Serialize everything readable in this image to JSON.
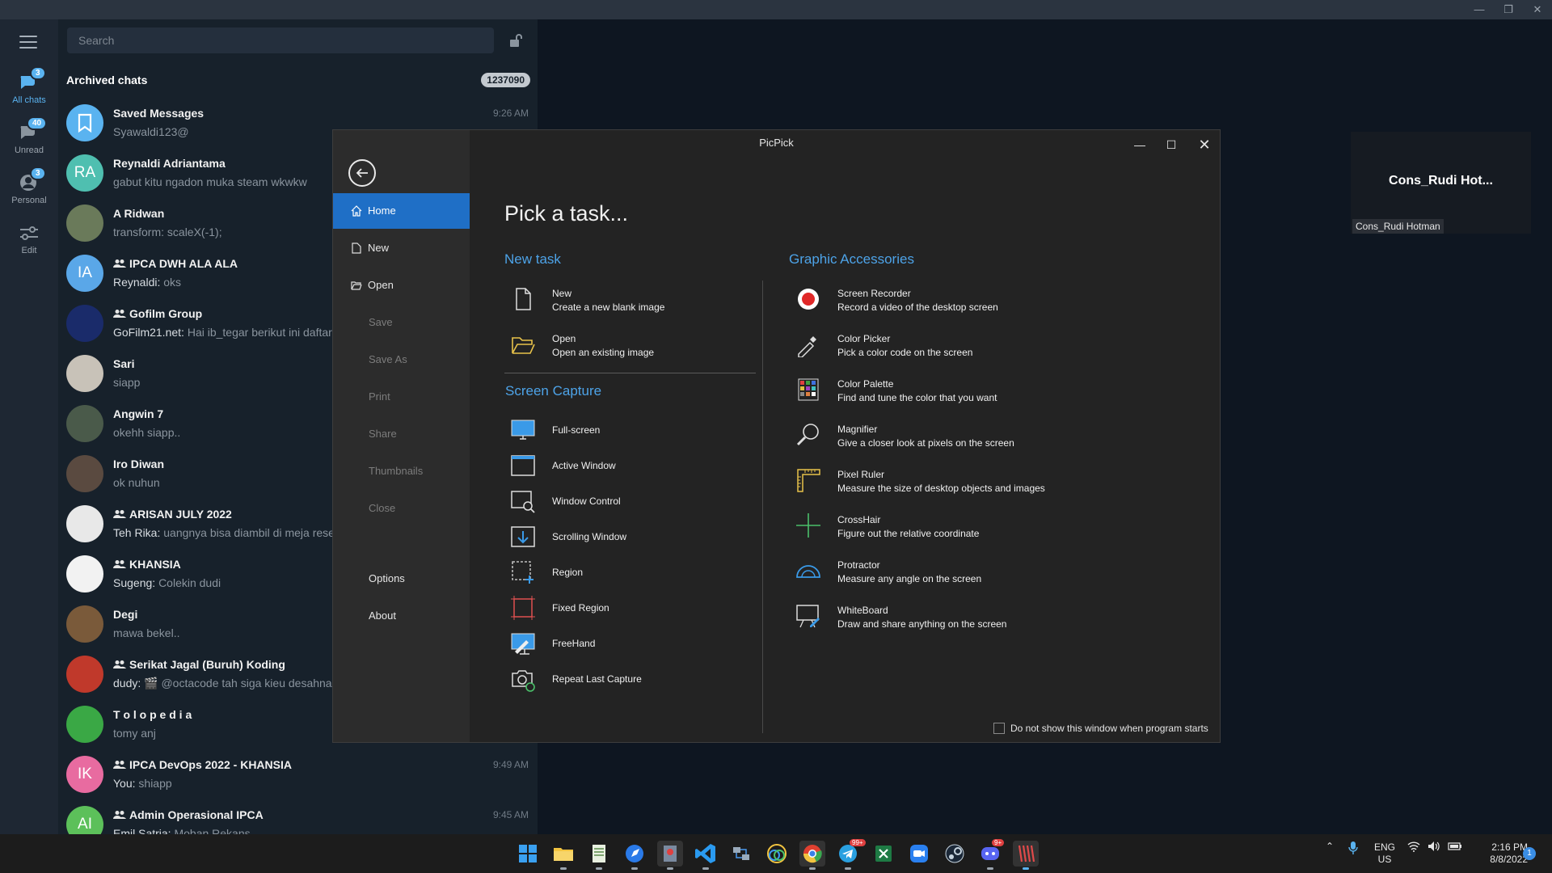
{
  "window": {
    "min": "—",
    "max": "❐",
    "close": "✕"
  },
  "rail": {
    "folders": [
      {
        "label": "All chats",
        "badge": "3"
      },
      {
        "label": "Unread",
        "badge": "40"
      },
      {
        "label": "Personal",
        "badge": "3"
      },
      {
        "label": "Edit",
        "badge": ""
      }
    ]
  },
  "chatlist": {
    "search_placeholder": "Search",
    "archived_title": "Archived chats",
    "archived_count": "1237090",
    "chats": [
      {
        "name": "Saved Messages",
        "sender": "",
        "text": "Syawaldi123@",
        "time": "9:26 AM",
        "initials": "",
        "color": "#5ab3f0",
        "group": false
      },
      {
        "name": "Reynaldi Adriantama",
        "sender": "",
        "text": "gabut kitu ngadon muka steam wkwkw",
        "time": "",
        "initials": "RA",
        "color": "#4fbfb0",
        "group": false
      },
      {
        "name": "A Ridwan",
        "sender": "",
        "text": "transform: scaleX(-1);",
        "time": "",
        "initials": "",
        "color": "#6a7a5a",
        "group": false
      },
      {
        "name": "IPCA DWH ALA ALA",
        "sender": "Reynaldi:",
        "text": "oks",
        "time": "",
        "initials": "IA",
        "color": "#5aa7e8",
        "group": true
      },
      {
        "name": "Gofilm Group",
        "sender": "GoFilm21.net:",
        "text": "Hai ib_tegar berikut ini daftar Fi",
        "time": "",
        "initials": "",
        "color": "#1a2b6a",
        "group": true
      },
      {
        "name": "Sari",
        "sender": "",
        "text": "siapp",
        "time": "",
        "initials": "",
        "color": "#c8c2b8",
        "group": false
      },
      {
        "name": "Angwin 7",
        "sender": "",
        "text": "okehh siapp..",
        "time": "",
        "initials": "",
        "color": "#4a5a4a",
        "group": false
      },
      {
        "name": "Iro Diwan",
        "sender": "",
        "text": "ok nuhun",
        "time": "",
        "initials": "",
        "color": "#5a4a40",
        "group": false
      },
      {
        "name": "ARISAN JULY 2022",
        "sender": "Teh Rika:",
        "text": "uangnya bisa diambil di meja reseps",
        "time": "",
        "initials": "",
        "color": "#e8e8e8",
        "group": true
      },
      {
        "name": "KHANSIA",
        "sender": "Sugeng:",
        "text": "Colekin dudi",
        "time": "",
        "initials": "",
        "color": "#f2f2f2",
        "group": true
      },
      {
        "name": "Degi",
        "sender": "",
        "text": "mawa bekel..",
        "time": "",
        "initials": "",
        "color": "#7a5a3a",
        "group": false
      },
      {
        "name": "Serikat Jagal (Buruh) Koding",
        "sender": "dudy:",
        "text": "🎬 @octacode tah siga kieu desahna p",
        "time": "",
        "initials": "",
        "color": "#c0392b",
        "group": true
      },
      {
        "name": "T o l o p e d i a",
        "sender": "",
        "text": "tomy anj",
        "time": "",
        "initials": "",
        "color": "#3aa845",
        "group": false
      },
      {
        "name": "IPCA DevOps 2022 - KHANSIA",
        "sender": "You:",
        "text": "shiapp",
        "time": "9:49 AM",
        "initials": "IK",
        "color": "#e86ba0",
        "group": true
      },
      {
        "name": "Admin Operasional IPCA",
        "sender": "Emil Satria:",
        "text": "Moban Rekans",
        "time": "9:45 AM",
        "initials": "AI",
        "color": "#5cc05a",
        "group": true
      }
    ]
  },
  "floatwin": {
    "title": "Cons_Rudi  Hot...",
    "label": "Cons_Rudi Hotman"
  },
  "picpick": {
    "title": "PicPick",
    "heading": "Pick a task...",
    "nav": {
      "home": "Home",
      "new": "New",
      "open": "Open",
      "save": "Save",
      "save_as": "Save As",
      "print": "Print",
      "share": "Share",
      "thumbnails": "Thumbnails",
      "close": "Close",
      "options": "Options",
      "about": "About"
    },
    "new_task": {
      "title": "New task",
      "items": [
        {
          "name": "New",
          "desc": "Create a new blank image"
        },
        {
          "name": "Open",
          "desc": "Open an existing image"
        }
      ]
    },
    "screen_capture": {
      "title": "Screen Capture",
      "items": [
        "Full-screen",
        "Active Window",
        "Window Control",
        "Scrolling Window",
        "Region",
        "Fixed Region",
        "FreeHand",
        "Repeat Last Capture"
      ]
    },
    "graphic_accessories": {
      "title": "Graphic Accessories",
      "items": [
        {
          "name": "Screen Recorder",
          "desc": "Record a video of the desktop screen"
        },
        {
          "name": "Color Picker",
          "desc": "Pick a color code on the screen"
        },
        {
          "name": "Color Palette",
          "desc": "Find and tune the color that you want"
        },
        {
          "name": "Magnifier",
          "desc": "Give a closer look at pixels on the screen"
        },
        {
          "name": "Pixel Ruler",
          "desc": "Measure the size of desktop objects and images"
        },
        {
          "name": "CrossHair",
          "desc": "Figure out the relative coordinate"
        },
        {
          "name": "Protractor",
          "desc": "Measure any angle on the screen"
        },
        {
          "name": "WhiteBoard",
          "desc": "Draw and share anything on the screen"
        }
      ]
    },
    "dont_show_label": "Do not show this window when program starts"
  },
  "taskbar": {
    "lang_top": "ENG",
    "lang_bottom": "US",
    "time": "2:16 PM",
    "date": "8/8/2022",
    "notification_count": "1",
    "telegram_badge": "99+",
    "discord_badge": "9+"
  }
}
